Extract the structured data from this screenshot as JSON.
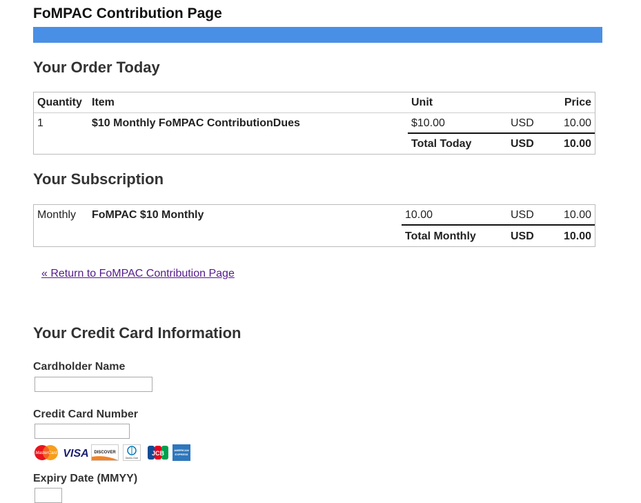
{
  "header": {
    "title": "FoMPAC Contribution Page"
  },
  "order": {
    "heading": "Your Order Today",
    "columns": {
      "quantity": "Quantity",
      "item": "Item",
      "unit": "Unit",
      "price": "Price"
    },
    "rows": [
      {
        "quantity": "1",
        "item": "$10 Monthly FoMPAC ContributionDues",
        "unit": "$10.00",
        "currency": "USD",
        "price": "10.00"
      }
    ],
    "total": {
      "label": "Total Today",
      "currency": "USD",
      "amount": "10.00"
    }
  },
  "subscription": {
    "heading": "Your Subscription",
    "rows": [
      {
        "period": "Monthly",
        "item": "FoMPAC $10 Monthly",
        "unit": "10.00",
        "currency": "USD",
        "price": "10.00"
      }
    ],
    "total": {
      "label": "Total Monthly",
      "currency": "USD",
      "amount": "10.00"
    }
  },
  "return_link": "« Return to FoMPAC Contribution Page",
  "credit_card": {
    "heading": "Your Credit Card Information",
    "cardholder_label": "Cardholder Name",
    "cardholder_value": "",
    "number_label": "Credit Card Number",
    "number_value": "",
    "expiry_label": "Expiry Date (MMYY)",
    "expiry_value": "",
    "card_logos": [
      {
        "name": "mastercard-icon",
        "text": "MasterCard"
      },
      {
        "name": "visa-icon",
        "text": "VISA"
      },
      {
        "name": "discover-icon",
        "text": "DISCOVER"
      },
      {
        "name": "diners-club-icon",
        "text": "Diners Club"
      },
      {
        "name": "jcb-icon",
        "text": "JCB"
      },
      {
        "name": "american-express-icon",
        "text": "AMERICAN EXPRESS"
      }
    ]
  },
  "colors": {
    "accent_bar": "#4a8fe6",
    "link": "#551a8b"
  }
}
